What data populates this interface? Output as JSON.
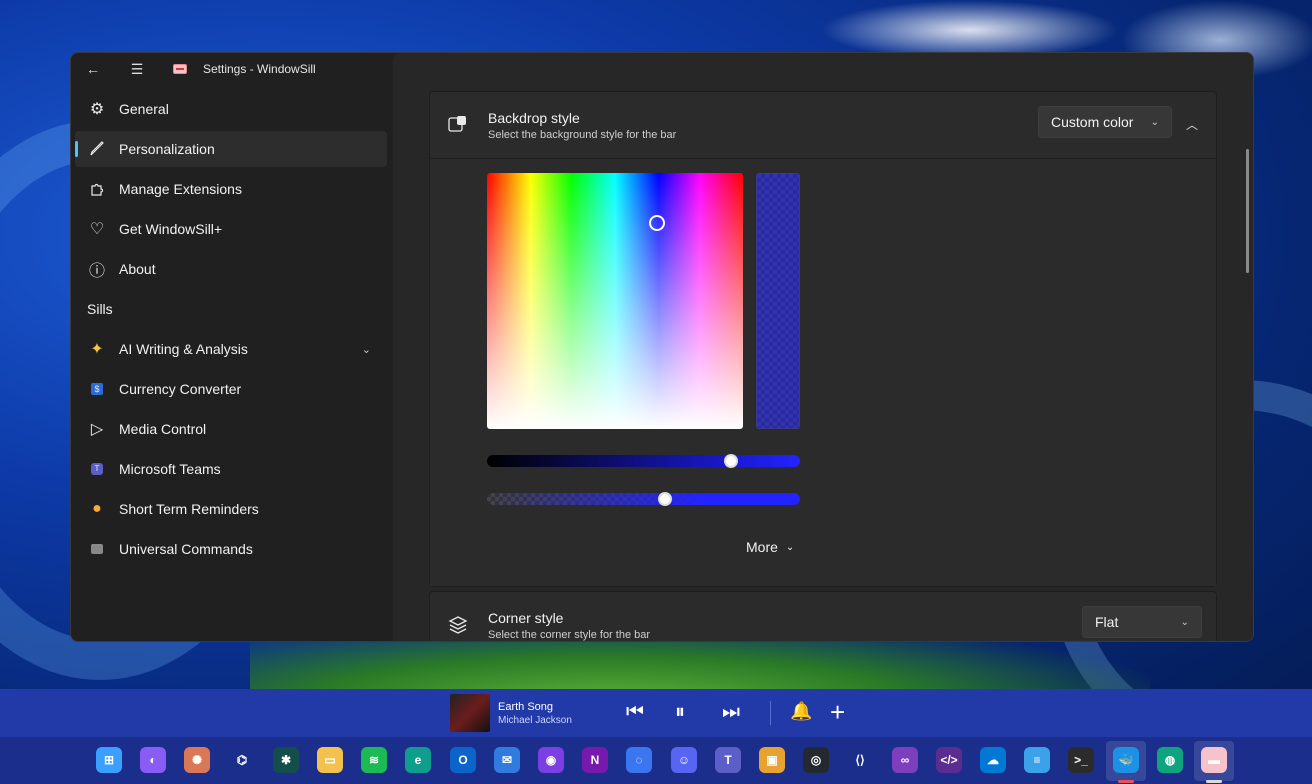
{
  "window": {
    "title": "Settings - WindowSill"
  },
  "sidebar": {
    "items": [
      {
        "label": "General",
        "icon": "gear-icon"
      },
      {
        "label": "Personalization",
        "icon": "brush-icon",
        "selected": true
      },
      {
        "label": "Manage Extensions",
        "icon": "puzzle-icon"
      },
      {
        "label": "Get WindowSill+",
        "icon": "heart-icon"
      },
      {
        "label": "About",
        "icon": "info-icon"
      }
    ],
    "section_header": "Sills",
    "sills": [
      {
        "label": "AI Writing & Analysis",
        "icon": "sparkle-icon",
        "expandable": true
      },
      {
        "label": "Currency Converter",
        "icon": "currency-icon"
      },
      {
        "label": "Media Control",
        "icon": "play-icon"
      },
      {
        "label": "Microsoft Teams",
        "icon": "teams-icon"
      },
      {
        "label": "Short Term Reminders",
        "icon": "bell-icon"
      },
      {
        "label": "Universal Commands",
        "icon": "command-icon"
      }
    ]
  },
  "backdrop_card": {
    "title": "Backdrop style",
    "description": "Select the background style for the bar",
    "selected_value": "Custom color",
    "more_label": "More",
    "value_slider": 0.78,
    "alpha_slider": 0.57
  },
  "corner_card": {
    "title": "Corner style",
    "description": "Select the corner style for the bar",
    "selected_value": "Flat"
  },
  "media": {
    "song": "Earth Song",
    "artist": "Michael Jackson"
  },
  "colors": {
    "accent": "#4cc2ff",
    "selected_color": "#2323ff",
    "window_bg": "#202020",
    "bar_bg": "#2239a8"
  },
  "taskbar_icons": [
    "windows-start-icon",
    "copilot-icon",
    "claude-icon",
    "chatgpt-icon",
    "perplexity-icon",
    "file-explorer-icon",
    "spotify-icon",
    "edge-icon",
    "outlook-icon",
    "mail-icon",
    "arc-icon",
    "onenote-icon",
    "signal-icon",
    "discord-icon",
    "teams-icon",
    "box-icon",
    "github-icon",
    "vscode-icon",
    "visual-studio-icon",
    "devtoys-icon",
    "azure-storage-icon",
    "notepad-icon",
    "terminal-icon",
    "docker-icon",
    "chatgpt-alt-icon",
    "windowsill-icon"
  ]
}
